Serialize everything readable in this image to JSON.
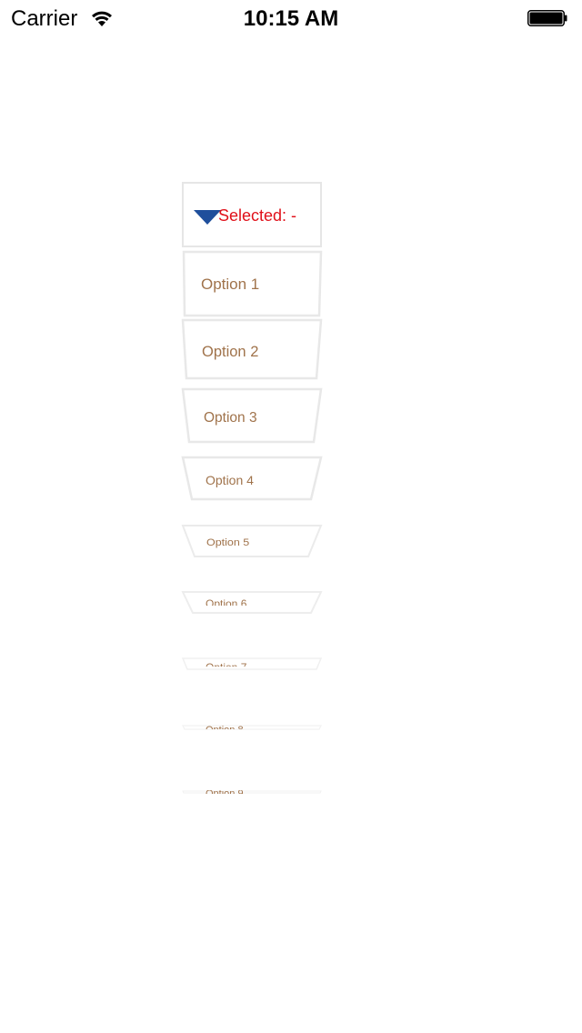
{
  "status_bar": {
    "carrier": "Carrier",
    "time": "10:15 AM",
    "icons": [
      "wifi-icon",
      "battery-icon"
    ]
  },
  "dropdown": {
    "selected_label": "Selected: -",
    "arrow_icon": "triangle-down-icon",
    "arrow_color": "#1f4f9c",
    "label_color": "#e0101a",
    "option_text_color": "#a0734b",
    "options": [
      "Option 1",
      "Option 2",
      "Option 3",
      "Option 4",
      "Option 5",
      "Option 6",
      "Option 7",
      "Option 8",
      "Option 9"
    ]
  }
}
